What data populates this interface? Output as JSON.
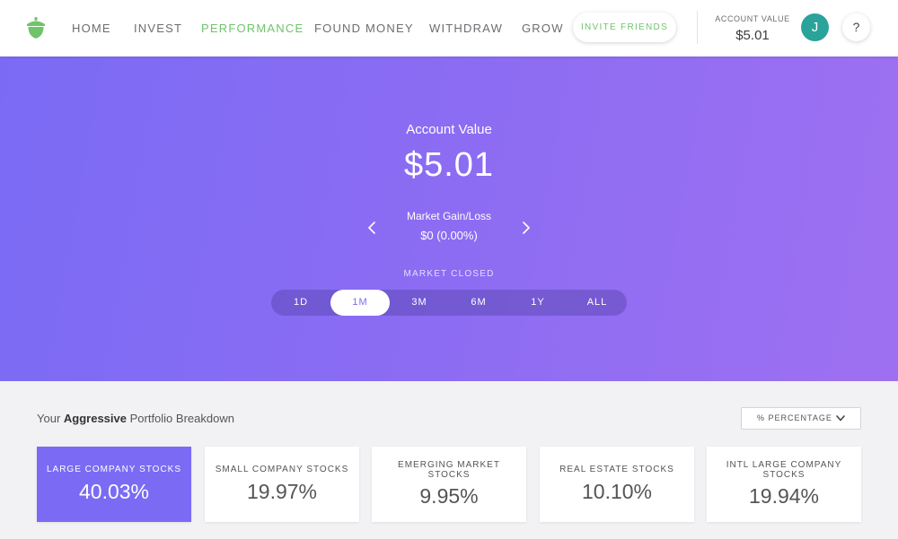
{
  "nav": {
    "items": [
      "HOME",
      "INVEST",
      "PERFORMANCE",
      "FOUND MONEY",
      "WITHDRAW",
      "GROW"
    ],
    "active": "PERFORMANCE",
    "invite_label": "INVITE FRIENDS",
    "account_label": "ACCOUNT VALUE",
    "account_value": "$5.01",
    "avatar_initial": "J",
    "help_label": "?"
  },
  "hero": {
    "account_label": "Account Value",
    "account_value": "$5.01",
    "gain_label": "Market Gain/Loss",
    "gain_value": "$0 (0.00%)",
    "market_status": "MARKET CLOSED",
    "ranges": [
      "1D",
      "1M",
      "3M",
      "6M",
      "1Y",
      "ALL"
    ],
    "selected_range": "1M"
  },
  "breakdown": {
    "title_prefix": "Your ",
    "title_emphasis": "Aggressive",
    "title_suffix": " Portfolio Breakdown",
    "view_option": "% PERCENTAGE",
    "cards": [
      {
        "label": "LARGE COMPANY STOCKS",
        "value": "40.03%",
        "active": true
      },
      {
        "label": "SMALL COMPANY STOCKS",
        "value": "19.97%",
        "active": false
      },
      {
        "label": "EMERGING MARKET STOCKS",
        "value": "9.95%",
        "active": false
      },
      {
        "label": "REAL ESTATE STOCKS",
        "value": "10.10%",
        "active": false
      },
      {
        "label": "INTL LARGE COMPANY STOCKS",
        "value": "19.94%",
        "active": false
      }
    ]
  },
  "colors": {
    "brand_green": "#6fc36b",
    "hero_gradient_start": "#7b6bf4",
    "hero_gradient_end": "#9e70f1",
    "avatar_teal": "#2aa39a",
    "active_card": "#7b6bf4"
  },
  "icons": {
    "logo": "acorn-icon",
    "prev": "chevron-left-icon",
    "next": "chevron-right-icon",
    "dropdown": "chevron-down-icon"
  }
}
